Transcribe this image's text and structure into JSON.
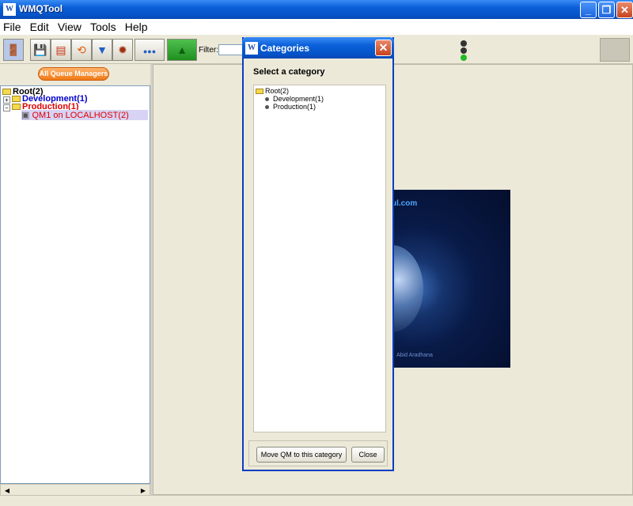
{
  "window": {
    "title": "WMQTool",
    "icon": "wmq-logo-icon",
    "icon_text": "W"
  },
  "menu": [
    "File",
    "Edit",
    "View",
    "Tools",
    "Help"
  ],
  "toolbar": {
    "buttons": [
      "exit-icon",
      "save-icon",
      "chart-icon",
      "refresh-icon",
      "filter-icon",
      "settings-icon",
      "queue-status-icon",
      "monitor-icon"
    ],
    "filter_label": "Filter:",
    "filter_value": "",
    "traffic_light": {
      "red": "#333333",
      "yellow": "#333333",
      "green": "#22bb22"
    }
  },
  "left_panel": {
    "all_qm_button": "All Queue Managers",
    "tree": {
      "root": "Root(2)",
      "development": "Development(1)",
      "production": "Production(1)",
      "qm": "QM1 on LOCALHOST(2)"
    },
    "colors": {
      "development": "#0000cc",
      "production": "#e00000",
      "qm": "#e00000"
    }
  },
  "splash": {
    "url": "ul.com",
    "author": "Abid Aradhana"
  },
  "dialog": {
    "title": "Categories",
    "icon_text": "W",
    "heading": "Select a category",
    "tree": {
      "root": "Root(2)",
      "children": [
        "Development(1)",
        "Production(1)"
      ]
    },
    "buttons": {
      "move": "Move QM to this category",
      "close": "Close"
    }
  }
}
